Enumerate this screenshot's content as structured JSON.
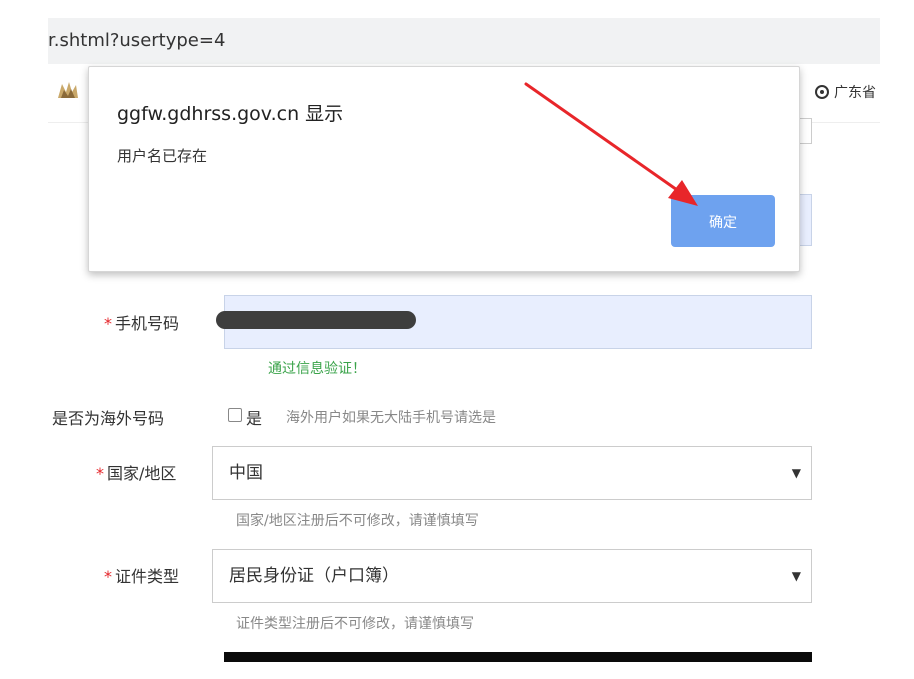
{
  "browser": {
    "url_fragment": "r.shtml?usertype=4"
  },
  "site": {
    "region_label": "广东省"
  },
  "dialog": {
    "origin": "ggfw.gdhrss.gov.cn 显示",
    "message": "用户名已存在",
    "ok_label": "确定"
  },
  "form": {
    "required_mark": "*",
    "phone": {
      "label": "手机号码",
      "verified_text": "通过信息验证！"
    },
    "overseas": {
      "label": "是否为海外号码",
      "checkbox_label": "是",
      "hint": "海外用户如果无大陆手机号请选是"
    },
    "country": {
      "label": "国家/地区",
      "value": "中国",
      "hint": "国家/地区注册后不可修改，请谨慎填写"
    },
    "id_type": {
      "label": "证件类型",
      "value": "居民身份证（户口簿）",
      "hint": "证件类型注册后不可修改，请谨慎填写"
    }
  },
  "colors": {
    "arrow": "#e8262a",
    "ok_button": "#6ea2ef",
    "verified_green": "#3aa34a",
    "required_red": "#e5252a",
    "input_fill": "#e8eefe"
  },
  "icons": {
    "caret": "▼"
  }
}
